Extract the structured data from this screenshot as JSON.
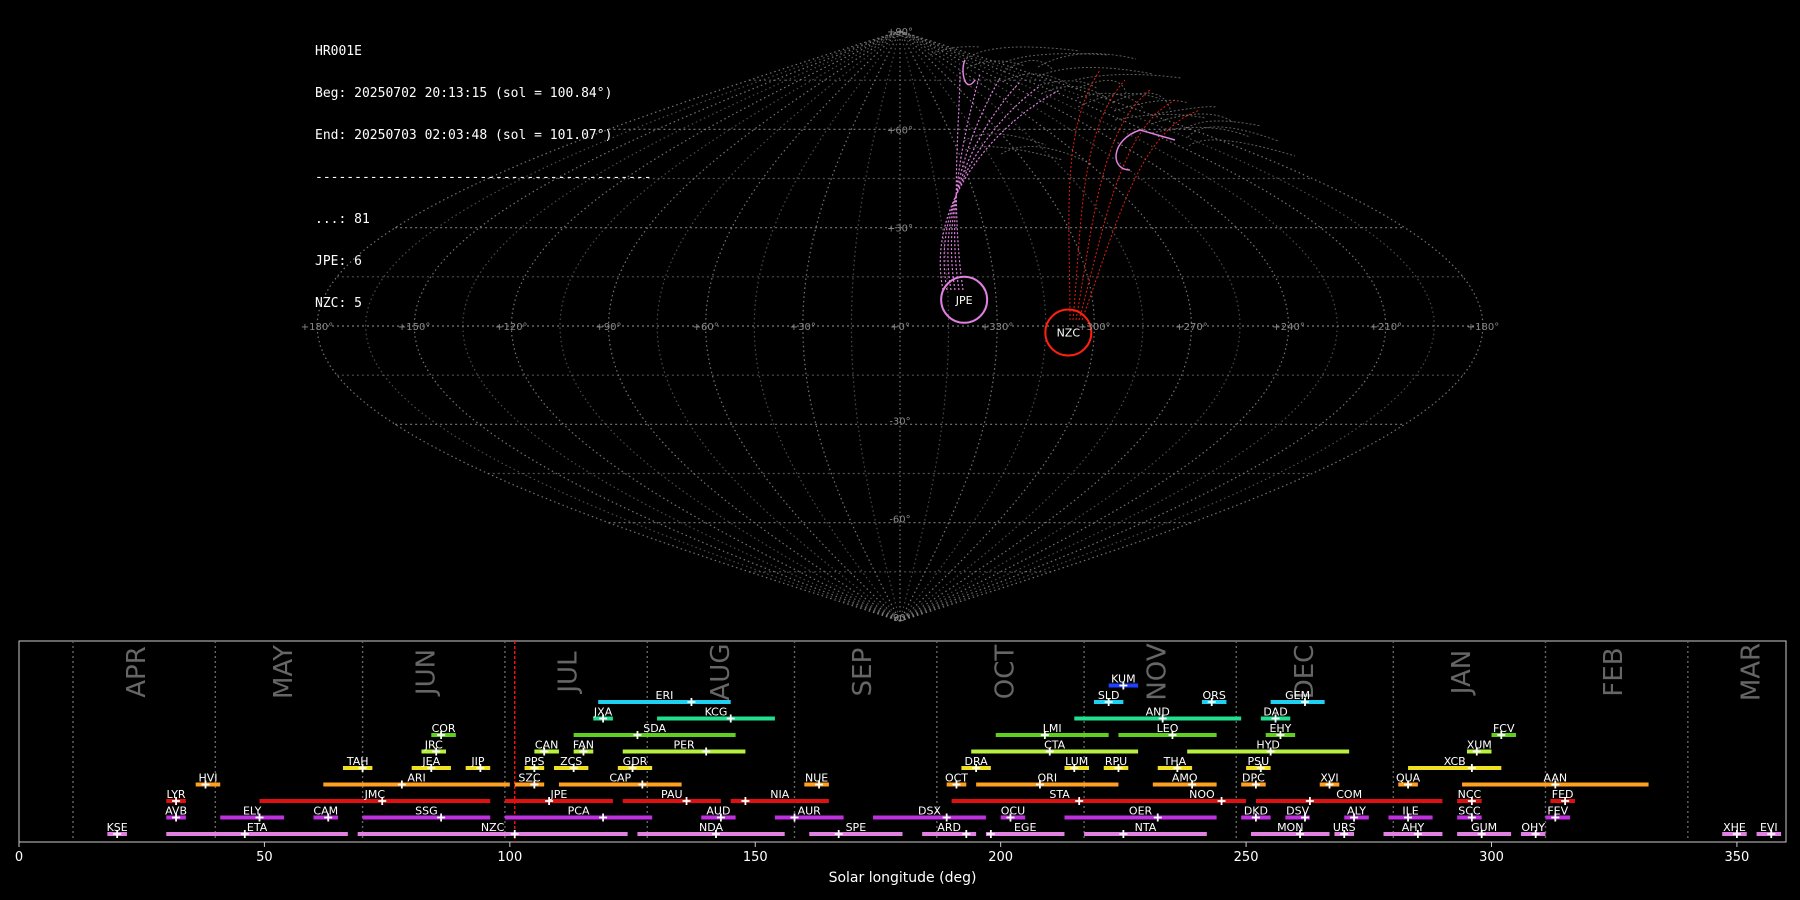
{
  "header": {
    "station": "HR001E",
    "begin": "Beg: 20250702 20:13:15 (sol = 100.84°)",
    "end": "End: 20250703 02:03:48 (sol = 101.07°)",
    "separator": "-------------------------------------------",
    "counts": [
      {
        "label": "...: 81"
      },
      {
        "label": "JPE: 6"
      },
      {
        "label": "NZC: 5"
      }
    ]
  },
  "sky_map": {
    "projection": "sinusoidal",
    "lat_labels": [
      "+90°",
      "+60°",
      "+30°",
      "0°",
      "-30°",
      "-60°",
      "-90°"
    ],
    "lon_labels": [
      "+180°",
      "+150°",
      "+120°",
      "+90°",
      "+60°",
      "+30°",
      "+0°",
      "+330°",
      "+300°",
      "+270°",
      "+240°",
      "+210°",
      "+180°"
    ],
    "radiants": [
      {
        "name": "JPE",
        "color": "#e080e0",
        "lon_offset": 20,
        "lat": 8
      },
      {
        "name": "NZC",
        "color": "#ff2010",
        "lon_offset": 52,
        "lat": -2
      }
    ],
    "colors": {
      "grid": "#888888",
      "sporadic": "#777777"
    }
  },
  "chart_data": {
    "type": "timeline",
    "xlabel": "Solar longitude (deg)",
    "xlim": [
      0,
      360
    ],
    "xticks": [
      0,
      50,
      100,
      150,
      200,
      250,
      300,
      350
    ],
    "current_sol": 101,
    "months": [
      {
        "name": "APR",
        "start": 11,
        "mid": 24
      },
      {
        "name": "MAY",
        "start": 40,
        "mid": 54
      },
      {
        "name": "JUN",
        "start": 70,
        "mid": 83
      },
      {
        "name": "JUL",
        "start": 99,
        "mid": 112
      },
      {
        "name": "AUG",
        "start": 128,
        "mid": 143
      },
      {
        "name": "SEP",
        "start": 158,
        "mid": 172
      },
      {
        "name": "OCT",
        "start": 187,
        "mid": 201
      },
      {
        "name": "NOV",
        "start": 217,
        "mid": 232
      },
      {
        "name": "DEC",
        "start": 248,
        "mid": 262
      },
      {
        "name": "JAN",
        "start": 280,
        "mid": 294
      },
      {
        "name": "FEB",
        "start": 311,
        "mid": 325
      },
      {
        "name": "MAR",
        "start": 340,
        "mid": 353
      }
    ],
    "showers": [
      {
        "name": "KSE",
        "row": 0,
        "start": 18,
        "end": 22,
        "peak": 20,
        "color": "#e080e0"
      },
      {
        "name": "ETA",
        "row": 0,
        "start": 30,
        "end": 67,
        "peak": 46,
        "color": "#e080e0"
      },
      {
        "name": "NZC",
        "row": 0,
        "start": 69,
        "end": 124,
        "peak": 101,
        "color": "#e080e0"
      },
      {
        "name": "NDA",
        "row": 0,
        "start": 126,
        "end": 156,
        "peak": 142,
        "color": "#e080e0"
      },
      {
        "name": "SPE",
        "row": 0,
        "start": 161,
        "end": 180,
        "peak": 167,
        "color": "#e080e0"
      },
      {
        "name": "ARD",
        "row": 0,
        "start": 184,
        "end": 195,
        "peak": 193,
        "color": "#e080e0"
      },
      {
        "name": "EGE",
        "row": 0,
        "start": 197,
        "end": 213,
        "peak": 198,
        "color": "#e080e0"
      },
      {
        "name": "NTA",
        "row": 0,
        "start": 217,
        "end": 242,
        "peak": 225,
        "color": "#e080e0"
      },
      {
        "name": "MON",
        "row": 0,
        "start": 251,
        "end": 267,
        "peak": 261,
        "color": "#e080e0"
      },
      {
        "name": "URS",
        "row": 0,
        "start": 268,
        "end": 272,
        "peak": 270,
        "color": "#e080e0"
      },
      {
        "name": "AHY",
        "row": 0,
        "start": 278,
        "end": 290,
        "peak": 285,
        "color": "#e080e0"
      },
      {
        "name": "GUM",
        "row": 0,
        "start": 293,
        "end": 304,
        "peak": 298,
        "color": "#e080e0"
      },
      {
        "name": "OHY",
        "row": 0,
        "start": 306,
        "end": 311,
        "peak": 309,
        "color": "#e080e0"
      },
      {
        "name": "XHE",
        "row": 0,
        "start": 347,
        "end": 352,
        "peak": 350,
        "color": "#e080e0"
      },
      {
        "name": "EVI",
        "row": 0,
        "start": 354,
        "end": 359,
        "peak": 357,
        "color": "#e080e0"
      },
      {
        "name": "AVB",
        "row": 1,
        "start": 30,
        "end": 34,
        "peak": 32,
        "color": "#c030e0"
      },
      {
        "name": "ELY",
        "row": 1,
        "start": 41,
        "end": 54,
        "peak": 49,
        "color": "#c030e0"
      },
      {
        "name": "CAM",
        "row": 1,
        "start": 60,
        "end": 65,
        "peak": 63,
        "color": "#c030e0"
      },
      {
        "name": "SSG",
        "row": 1,
        "start": 70,
        "end": 96,
        "peak": 86,
        "color": "#c030e0"
      },
      {
        "name": "PCA",
        "row": 1,
        "start": 99,
        "end": 129,
        "peak": 119,
        "color": "#c030e0"
      },
      {
        "name": "AUD",
        "row": 1,
        "start": 139,
        "end": 146,
        "peak": 143,
        "color": "#c030e0"
      },
      {
        "name": "AUR",
        "row": 1,
        "start": 154,
        "end": 168,
        "peak": 158,
        "color": "#c030e0"
      },
      {
        "name": "DSX",
        "row": 1,
        "start": 174,
        "end": 197,
        "peak": 189,
        "color": "#c030e0"
      },
      {
        "name": "OCU",
        "row": 1,
        "start": 200,
        "end": 205,
        "peak": 202,
        "color": "#c030e0"
      },
      {
        "name": "OER",
        "row": 1,
        "start": 213,
        "end": 244,
        "peak": 232,
        "color": "#c030e0"
      },
      {
        "name": "DKD",
        "row": 1,
        "start": 249,
        "end": 255,
        "peak": 252,
        "color": "#c030e0"
      },
      {
        "name": "DSV",
        "row": 1,
        "start": 258,
        "end": 263,
        "peak": 262,
        "color": "#c030e0"
      },
      {
        "name": "ALY",
        "row": 1,
        "start": 270,
        "end": 275,
        "peak": 272,
        "color": "#c030e0"
      },
      {
        "name": "ILE",
        "row": 1,
        "start": 279,
        "end": 288,
        "peak": 283,
        "color": "#c030e0"
      },
      {
        "name": "SCC",
        "row": 1,
        "start": 293,
        "end": 298,
        "peak": 296,
        "color": "#c030e0"
      },
      {
        "name": "FEV",
        "row": 1,
        "start": 311,
        "end": 316,
        "peak": 313,
        "color": "#c030e0"
      },
      {
        "name": "LYR",
        "row": 2,
        "start": 30,
        "end": 34,
        "peak": 32,
        "color": "#e01010"
      },
      {
        "name": "JMC",
        "row": 2,
        "start": 49,
        "end": 96,
        "peak": 74,
        "color": "#e01010"
      },
      {
        "name": "JPE",
        "row": 2,
        "start": 99,
        "end": 121,
        "peak": 108,
        "color": "#e01010"
      },
      {
        "name": "PAU",
        "row": 2,
        "start": 123,
        "end": 143,
        "peak": 136,
        "color": "#e01010"
      },
      {
        "name": "NIA",
        "row": 2,
        "start": 145,
        "end": 165,
        "peak": 148,
        "color": "#e01010"
      },
      {
        "name": "STA",
        "row": 2,
        "start": 190,
        "end": 234,
        "peak": 216,
        "color": "#e01010"
      },
      {
        "name": "NOO",
        "row": 2,
        "start": 232,
        "end": 250,
        "peak": 245,
        "color": "#e01010"
      },
      {
        "name": "COM",
        "row": 2,
        "start": 252,
        "end": 290,
        "peak": 263,
        "color": "#e01010"
      },
      {
        "name": "NCC",
        "row": 2,
        "start": 293,
        "end": 298,
        "peak": 296,
        "color": "#e01010"
      },
      {
        "name": "FED",
        "row": 2,
        "start": 312,
        "end": 317,
        "peak": 315,
        "color": "#e01010"
      },
      {
        "name": "HVI",
        "row": 3,
        "start": 36,
        "end": 41,
        "peak": 38,
        "color": "#ffa020"
      },
      {
        "name": "ARI",
        "row": 3,
        "start": 62,
        "end": 100,
        "peak": 78,
        "color": "#ffa020"
      },
      {
        "name": "SZC",
        "row": 3,
        "start": 101,
        "end": 107,
        "peak": 105,
        "color": "#ffa020"
      },
      {
        "name": "CAP",
        "row": 3,
        "start": 110,
        "end": 135,
        "peak": 127,
        "color": "#ffa020"
      },
      {
        "name": "NUE",
        "row": 3,
        "start": 160,
        "end": 165,
        "peak": 163,
        "color": "#ffa020"
      },
      {
        "name": "OCT",
        "row": 3,
        "start": 189,
        "end": 193,
        "peak": 191,
        "color": "#ffa020"
      },
      {
        "name": "ORI",
        "row": 3,
        "start": 195,
        "end": 224,
        "peak": 208,
        "color": "#ffa020"
      },
      {
        "name": "AMO",
        "row": 3,
        "start": 231,
        "end": 244,
        "peak": 239,
        "color": "#ffa020"
      },
      {
        "name": "DPC",
        "row": 3,
        "start": 249,
        "end": 254,
        "peak": 252,
        "color": "#ffa020"
      },
      {
        "name": "XVI",
        "row": 3,
        "start": 265,
        "end": 269,
        "peak": 267,
        "color": "#ffa020"
      },
      {
        "name": "QUA",
        "row": 3,
        "start": 281,
        "end": 285,
        "peak": 283,
        "color": "#ffa020"
      },
      {
        "name": "AAN",
        "row": 3,
        "start": 294,
        "end": 332,
        "peak": 313,
        "color": "#ffa020"
      },
      {
        "name": "TAH",
        "row": 4,
        "start": 66,
        "end": 72,
        "peak": 70,
        "color": "#f0e020"
      },
      {
        "name": "JEA",
        "row": 4,
        "start": 80,
        "end": 88,
        "peak": 84,
        "color": "#f0e020"
      },
      {
        "name": "JIP",
        "row": 4,
        "start": 91,
        "end": 96,
        "peak": 94,
        "color": "#f0e020"
      },
      {
        "name": "PPS",
        "row": 4,
        "start": 103,
        "end": 107,
        "peak": 105,
        "color": "#f0e020"
      },
      {
        "name": "ZCS",
        "row": 4,
        "start": 109,
        "end": 116,
        "peak": 113,
        "color": "#f0e020"
      },
      {
        "name": "GDR",
        "row": 4,
        "start": 122,
        "end": 129,
        "peak": 125,
        "color": "#f0e020"
      },
      {
        "name": "DRA",
        "row": 4,
        "start": 192,
        "end": 198,
        "peak": 195,
        "color": "#f0e020"
      },
      {
        "name": "LUM",
        "row": 4,
        "start": 213,
        "end": 218,
        "peak": 215,
        "color": "#f0e020"
      },
      {
        "name": "RPU",
        "row": 4,
        "start": 221,
        "end": 226,
        "peak": 224,
        "color": "#f0e020"
      },
      {
        "name": "THA",
        "row": 4,
        "start": 232,
        "end": 239,
        "peak": 236,
        "color": "#f0e020"
      },
      {
        "name": "PSU",
        "row": 4,
        "start": 250,
        "end": 255,
        "peak": 253,
        "color": "#f0e020"
      },
      {
        "name": "XCB",
        "row": 4,
        "start": 283,
        "end": 302,
        "peak": 296,
        "color": "#f0e020"
      },
      {
        "name": "JRC",
        "row": 5,
        "start": 82,
        "end": 87,
        "peak": 85,
        "color": "#b8f040"
      },
      {
        "name": "CAN",
        "row": 5,
        "start": 105,
        "end": 110,
        "peak": 107,
        "color": "#b8f040"
      },
      {
        "name": "FAN",
        "row": 5,
        "start": 113,
        "end": 117,
        "peak": 115,
        "color": "#b8f040"
      },
      {
        "name": "PER",
        "row": 5,
        "start": 123,
        "end": 148,
        "peak": 140,
        "color": "#b8f040"
      },
      {
        "name": "CTA",
        "row": 5,
        "start": 194,
        "end": 228,
        "peak": 210,
        "color": "#b8f040"
      },
      {
        "name": "HYD",
        "row": 5,
        "start": 238,
        "end": 271,
        "peak": 255,
        "color": "#b8f040"
      },
      {
        "name": "XUM",
        "row": 5,
        "start": 295,
        "end": 300,
        "peak": 297,
        "color": "#b8f040"
      },
      {
        "name": "COR",
        "row": 6,
        "start": 84,
        "end": 89,
        "peak": 86,
        "color": "#60d020"
      },
      {
        "name": "SDA",
        "row": 6,
        "start": 113,
        "end": 146,
        "peak": 126,
        "color": "#60d020"
      },
      {
        "name": "LMI",
        "row": 6,
        "start": 199,
        "end": 222,
        "peak": 209,
        "color": "#60d020"
      },
      {
        "name": "LEO",
        "row": 6,
        "start": 224,
        "end": 244,
        "peak": 235,
        "color": "#60d020"
      },
      {
        "name": "EHY",
        "row": 6,
        "start": 254,
        "end": 260,
        "peak": 257,
        "color": "#60d020"
      },
      {
        "name": "FCV",
        "row": 6,
        "start": 300,
        "end": 305,
        "peak": 302,
        "color": "#60d020"
      },
      {
        "name": "JXA",
        "row": 7,
        "start": 117,
        "end": 121,
        "peak": 119,
        "color": "#20e090"
      },
      {
        "name": "KCG",
        "row": 7,
        "start": 130,
        "end": 154,
        "peak": 145,
        "color": "#20e090"
      },
      {
        "name": "AND",
        "row": 7,
        "start": 215,
        "end": 249,
        "peak": 233,
        "color": "#20e090"
      },
      {
        "name": "DAD",
        "row": 7,
        "start": 253,
        "end": 259,
        "peak": 256,
        "color": "#20e090"
      },
      {
        "name": "ERI",
        "row": 8,
        "start": 118,
        "end": 145,
        "peak": 137,
        "color": "#20d0f0"
      },
      {
        "name": "SLD",
        "row": 8,
        "start": 219,
        "end": 225,
        "peak": 222,
        "color": "#20d0f0"
      },
      {
        "name": "ORS",
        "row": 8,
        "start": 241,
        "end": 246,
        "peak": 243,
        "color": "#20d0f0"
      },
      {
        "name": "GEM",
        "row": 8,
        "start": 255,
        "end": 266,
        "peak": 262,
        "color": "#20d0f0"
      },
      {
        "name": "KUM",
        "row": 9,
        "start": 222,
        "end": 228,
        "peak": 225,
        "color": "#2040ff"
      }
    ]
  }
}
